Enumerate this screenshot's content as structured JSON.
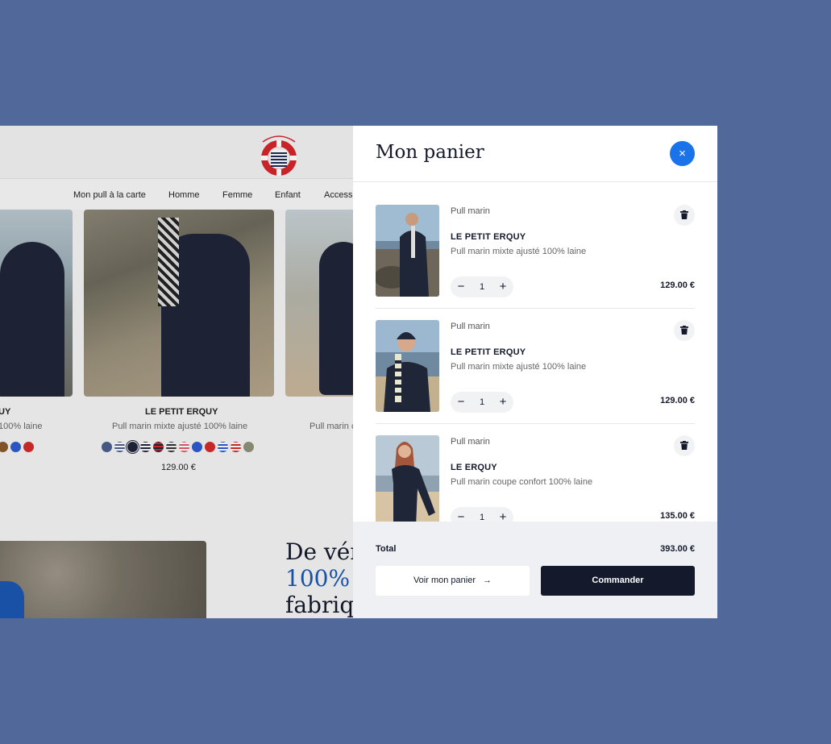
{
  "shop": {
    "nav": [
      "Mon pull à la carte",
      "Homme",
      "Femme",
      "Enfant",
      "Accessoires"
    ],
    "cards": [
      {
        "title": "UY",
        "subtitle": "100% laine"
      },
      {
        "title": "LE PETIT ERQUY",
        "subtitle": "Pull marin mixte ajusté 100% laine",
        "price": "129.00 €"
      },
      {
        "subtitle": "Pull marin c"
      }
    ],
    "headline": {
      "line1": "De vér",
      "line2": "100%",
      "line3": "fabriq"
    }
  },
  "cart": {
    "title": "Mon panier",
    "close_icon": "×",
    "items": [
      {
        "category": "Pull marin",
        "name": "LE PETIT ERQUY",
        "description": "Pull marin mixte ajusté 100% laine",
        "quantity": "1",
        "price": "129.00 €"
      },
      {
        "category": "Pull marin",
        "name": "LE PETIT ERQUY",
        "description": "Pull marin mixte ajusté 100% laine",
        "quantity": "1",
        "price": "129.00 €"
      },
      {
        "category": "Pull marin",
        "name": "LE  ERQUY",
        "description": "Pull marin coupe confort 100% laine",
        "quantity": "1",
        "price": "135.00 €"
      }
    ],
    "total_label": "Total",
    "total_value": "393.00 €",
    "view_cart_label": "Voir mon panier",
    "view_cart_arrow": "→",
    "order_label": "Commander"
  },
  "colors": {
    "background": "#50699a",
    "accent": "#1a73e8",
    "navy": "#141a2b"
  }
}
